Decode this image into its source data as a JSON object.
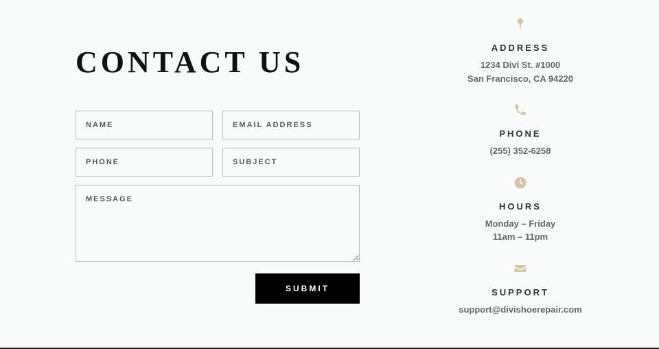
{
  "heading": "CONTACT US",
  "form": {
    "name_placeholder": "NAME",
    "email_placeholder": "EMAIL ADDRESS",
    "phone_placeholder": "PHONE",
    "subject_placeholder": "SUBJECT",
    "message_placeholder": "MESSAGE",
    "submit_label": "SUBMIT"
  },
  "info": {
    "address": {
      "title": "ADDRESS",
      "line1": "1234 Divi St. #1000",
      "line2": "San Francisco, CA 94220"
    },
    "phone": {
      "title": "PHONE",
      "value": "(255) 352-6258"
    },
    "hours": {
      "title": "HOURS",
      "line1": "Monday – Friday",
      "line2": "11am – 11pm"
    },
    "support": {
      "title": "SUPPORT",
      "email": "support@divishoerepair.com"
    }
  }
}
